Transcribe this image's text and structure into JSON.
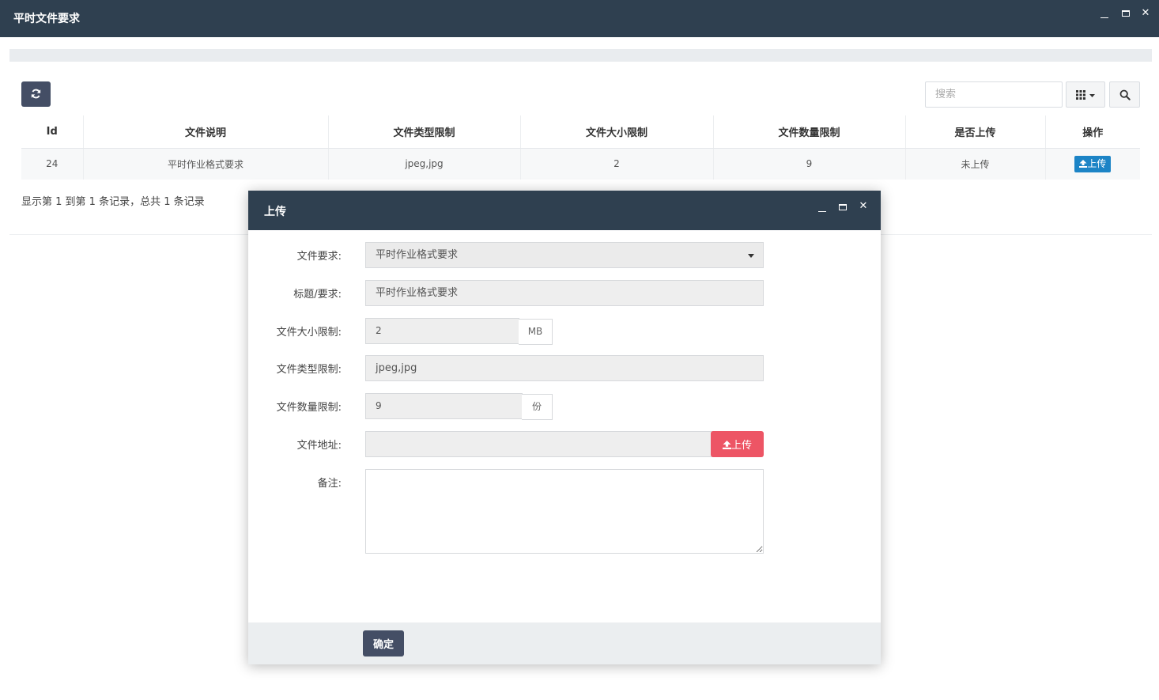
{
  "window": {
    "title": "平时文件要求"
  },
  "toolbar": {
    "search_placeholder": "搜索"
  },
  "icons": {
    "refresh": "refresh-icon",
    "columns": "grid-icon",
    "search": "search-icon",
    "upload": "upload-icon",
    "minimize": "minimize-icon",
    "maximize": "maximize-icon",
    "close": "close-icon"
  },
  "table": {
    "columns": [
      "Id",
      "文件说明",
      "文件类型限制",
      "文件大小限制",
      "文件数量限制",
      "是否上传",
      "操作"
    ],
    "rows": [
      {
        "id": "24",
        "desc": "平时作业格式要求",
        "types": "jpeg,jpg",
        "size": "2",
        "count": "9",
        "uploaded": "未上传",
        "action": "上传"
      }
    ]
  },
  "pagination": {
    "text": "显示第 1 到第 1 条记录，总共 1 条记录"
  },
  "dialog": {
    "title": "上传",
    "fields": {
      "requirement": {
        "label": "文件要求:",
        "value": "平时作业格式要求"
      },
      "title": {
        "label": "标题/要求:",
        "value": "平时作业格式要求"
      },
      "size_limit": {
        "label": "文件大小限制:",
        "value": "2",
        "unit": "MB"
      },
      "type_limit": {
        "label": "文件类型限制:",
        "value": "jpeg,jpg"
      },
      "count_limit": {
        "label": "文件数量限制:",
        "value": "9",
        "unit": "份"
      },
      "address": {
        "label": "文件地址:",
        "value": "",
        "button": "上传"
      },
      "remark": {
        "label": "备注:",
        "value": ""
      }
    },
    "ok_label": "确定"
  },
  "colors": {
    "header_bg": "#2f4050",
    "primary_dark": "#444e65",
    "upload_blue": "#1c84c6",
    "upload_red": "#ed5565"
  }
}
